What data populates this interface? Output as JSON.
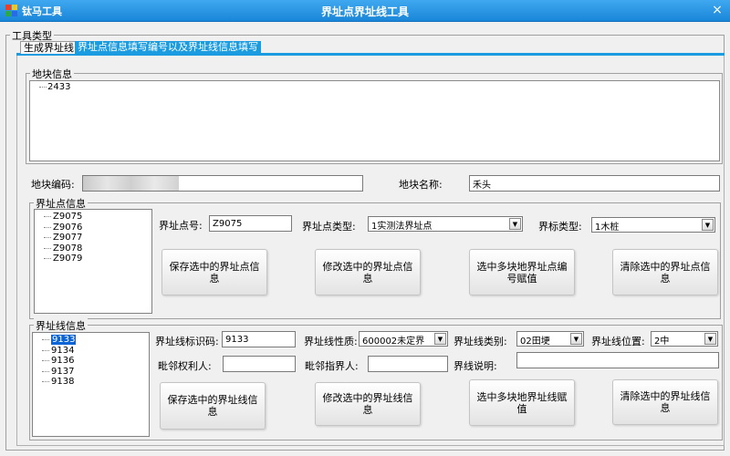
{
  "window": {
    "app_name": "钛马工具",
    "title": "界址点界址线工具",
    "close_glyph": "×"
  },
  "tool_type_legend": "工具类型",
  "tabs": [
    {
      "label": "生成界址线"
    },
    {
      "label": "界址点信息填写编号以及界址线信息填写"
    }
  ],
  "plot_info": {
    "legend": "地块信息",
    "tree_items": [
      "2433"
    ]
  },
  "plot_code": {
    "label": "地块编码:",
    "value": ""
  },
  "plot_name": {
    "label": "地块名称:",
    "value": "禾头"
  },
  "boundary_point": {
    "legend": "界址点信息",
    "list": [
      "Z9075",
      "Z9076",
      "Z9077",
      "Z9078",
      "Z9079"
    ],
    "number_label": "界址点号:",
    "number_value": "Z9075",
    "type_label": "界址点类型:",
    "type_value": "1实测法界址点",
    "marker_label": "界标类型:",
    "marker_value": "1木桩",
    "buttons": {
      "save": "保存选中的界址点信息",
      "modify": "修改选中的界址点信息",
      "batch": "选中多块地界址点编号赋值",
      "clear": "清除选中的界址点信息"
    }
  },
  "boundary_line": {
    "legend": "界址线信息",
    "list": [
      "9133",
      "9134",
      "9136",
      "9137",
      "9138"
    ],
    "id_label": "界址线标识码:",
    "id_value": "9133",
    "nature_label": "界址线性质:",
    "nature_value": "600002未定界",
    "category_label": "界址线类别:",
    "category_value": "02田埂",
    "position_label": "界址线位置:",
    "position_value": "2中",
    "neighbor_right_label": "毗邻权利人:",
    "neighbor_right_value": "",
    "neighbor_pointer_label": "毗邻指界人:",
    "neighbor_pointer_value": "",
    "desc_label": "界线说明:",
    "desc_value": "",
    "buttons": {
      "save": "保存选中的界址线信息",
      "modify": "修改选中的界址线信息",
      "batch": "选中多块地界址线赋值",
      "clear": "清除选中的界址线信息"
    }
  },
  "colors": {
    "titlebar": "#1a86d8",
    "active_tab": "#1b9be0",
    "selection": "#0a64d6"
  }
}
